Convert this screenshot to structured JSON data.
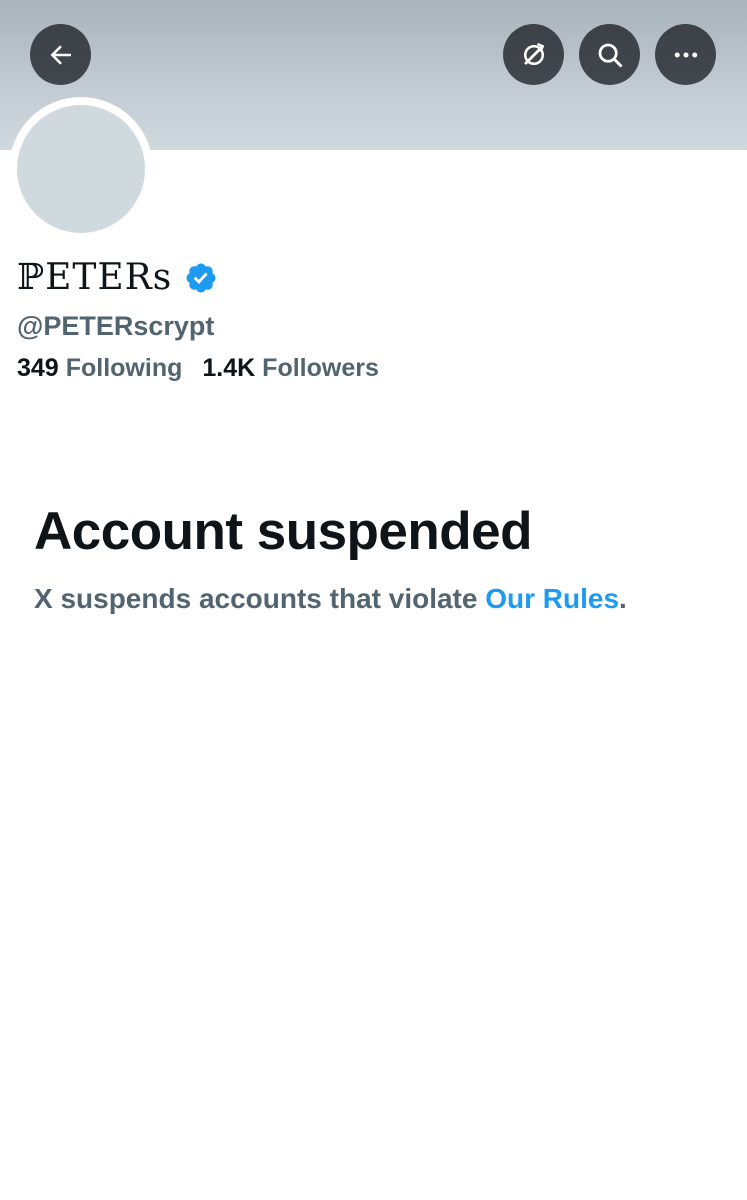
{
  "header": {
    "back_icon": "arrow-left-icon",
    "translate_icon": "translate-off-icon",
    "search_icon": "search-icon",
    "more_icon": "more-horizontal-icon"
  },
  "profile": {
    "display_name": "ℙETERs",
    "verified": true,
    "verified_color": "#1d9bf0",
    "handle": "@PETERscrypt",
    "following_count": "349",
    "following_label": "Following",
    "followers_count": "1.4K",
    "followers_label": "Followers"
  },
  "notice": {
    "title": "Account suspended",
    "message": "X suspends accounts that violate ",
    "link_text": "Our Rules",
    "trailing": "."
  },
  "colors": {
    "banner": "#cfd9de",
    "avatar_placeholder": "#cfd9de",
    "secondary_text": "#536471",
    "link": "#1d9bf0",
    "primary_text": "#0f1419"
  }
}
